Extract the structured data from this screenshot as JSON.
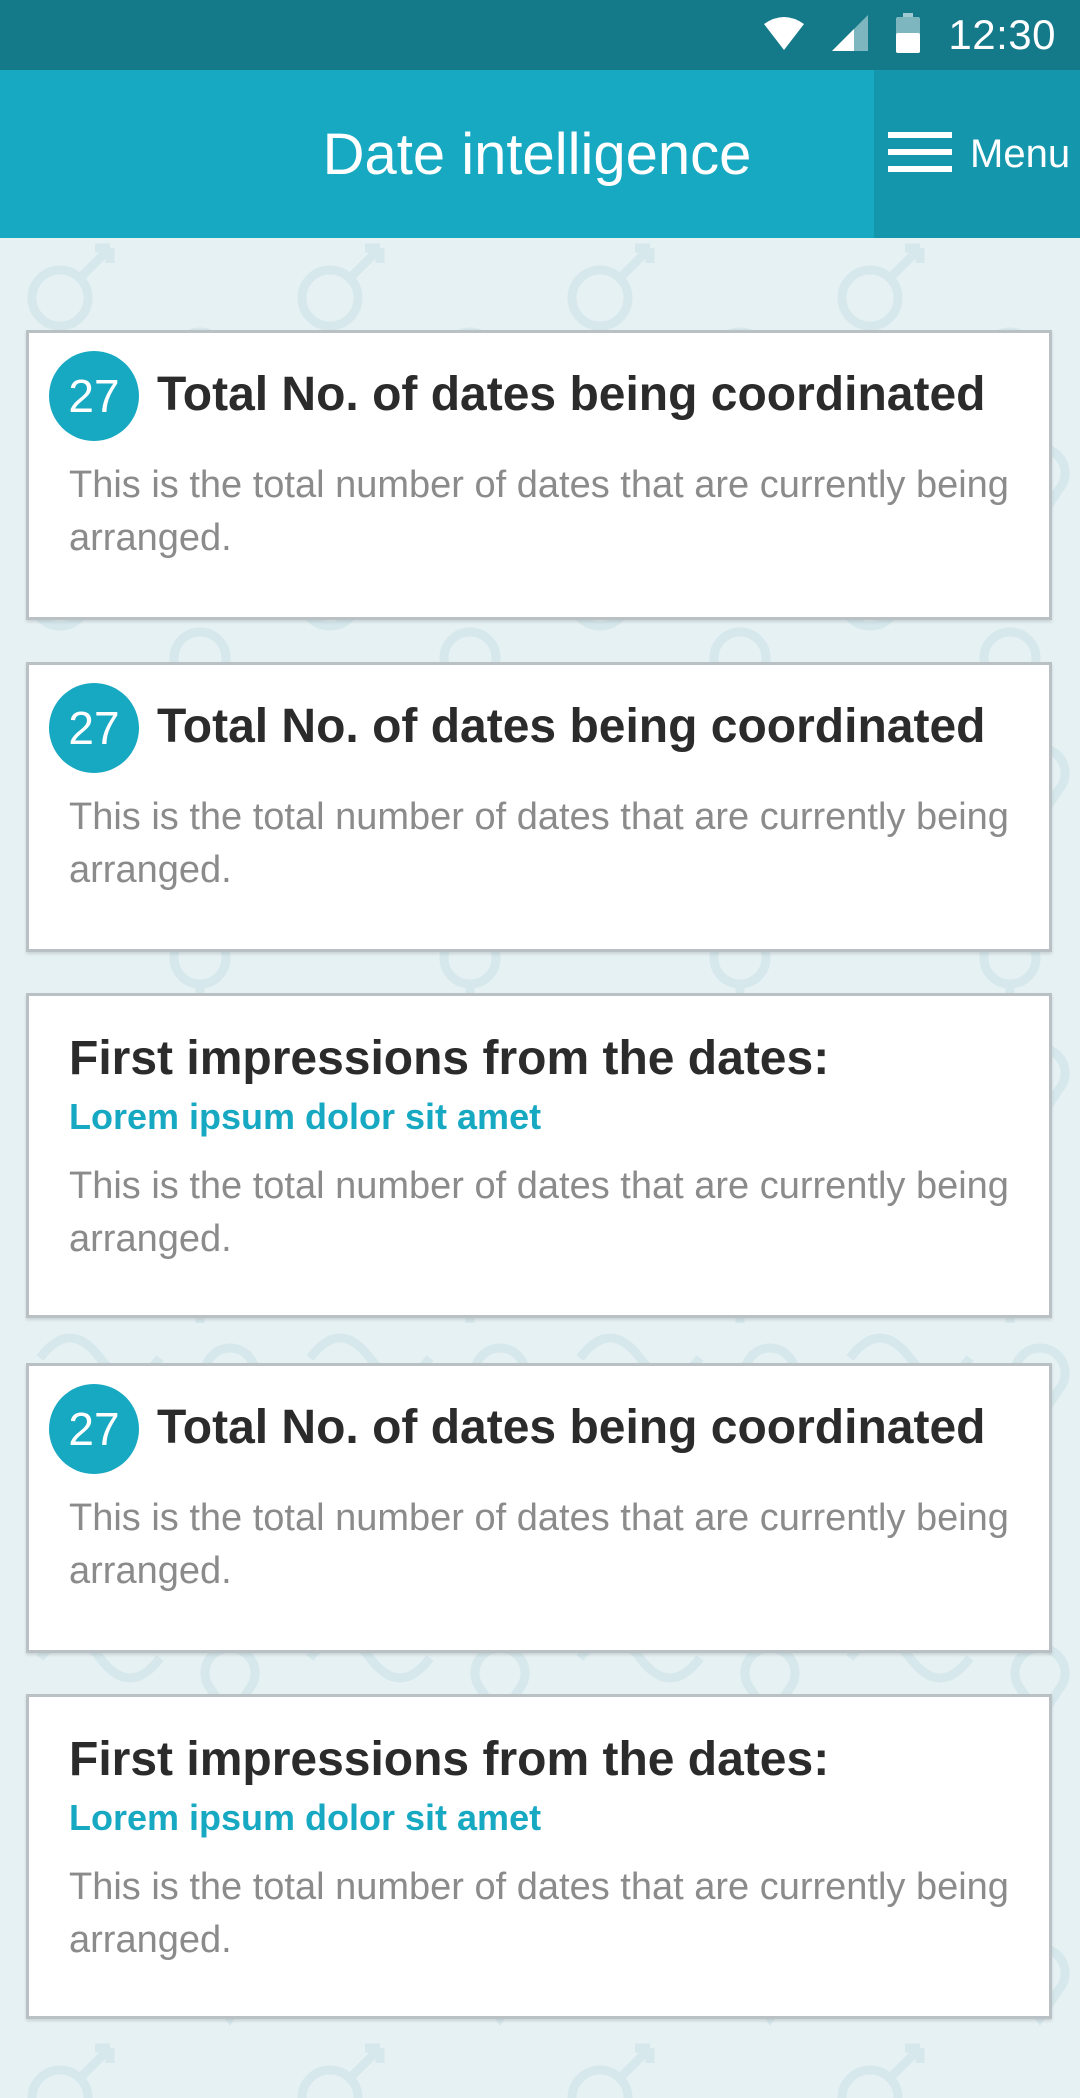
{
  "status_bar": {
    "time": "12:30",
    "icons": [
      "wifi-icon",
      "cell-signal-icon",
      "battery-icon"
    ]
  },
  "app_bar": {
    "title": "Date intelligence",
    "menu_label": "Menu",
    "menu_icon": "hamburger-icon"
  },
  "colors": {
    "accent": "#17a8c2",
    "status_bar": "#147a8a",
    "menu_button": "#1497ad",
    "background": "#e6f1f3",
    "title_text": "#2b2b2b",
    "description_text": "#8b8b8b"
  },
  "cards": [
    {
      "count": "27",
      "title": "Total No. of dates being coordinated",
      "description": "This is the total number of dates that are currently being arranged."
    },
    {
      "count": "27",
      "title": "Total No. of dates being coordinated",
      "description": "This is the total number of dates that are currently being arranged."
    },
    {
      "title": "First impressions from the dates:",
      "subtitle": "Lorem ipsum dolor sit amet",
      "description": "This is the total number of dates that are currently being arranged."
    },
    {
      "count": "27",
      "title": "Total No. of dates being coordinated",
      "description": "This is the total number of dates that are currently being arranged."
    },
    {
      "title": "First impressions from the dates:",
      "subtitle": "Lorem ipsum dolor sit amet",
      "description": "This is the total number of dates that are currently being arranged."
    }
  ]
}
